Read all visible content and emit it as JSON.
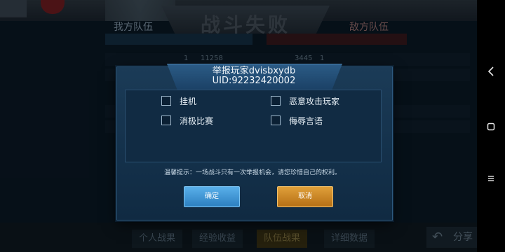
{
  "background": {
    "page_title": "战斗失败",
    "team_ours_label": "我方队伍",
    "team_enemy_label": "敌方队伍",
    "score_row": {
      "our_rank": "1",
      "our_score": "11258",
      "enemy_score": "3445",
      "enemy_rank": "1"
    },
    "bottom_tabs": [
      "个人战果",
      "经验收益",
      "队伍战果",
      "详细数据"
    ],
    "active_tab_index": 2,
    "share_label": "分享"
  },
  "report_dialog": {
    "title": "举报玩家dvisbxydb",
    "uid": "UID:92232420002",
    "options": [
      {
        "label": "挂机",
        "checked": false
      },
      {
        "label": "恶意攻击玩家",
        "checked": false
      },
      {
        "label": "消极比赛",
        "checked": false
      },
      {
        "label": "侮辱言语",
        "checked": false
      }
    ],
    "tip": "温馨提示：一场战斗只有一次举报机会，请您珍惜自己的权利。",
    "confirm_label": "确定",
    "cancel_label": "取消"
  },
  "colors": {
    "confirm_button": "#3c92d4",
    "cancel_button": "#cc8a28",
    "dialog_bg": "#14314b"
  },
  "system_nav": {
    "back_icon": "back-icon",
    "home_icon": "home-icon",
    "menu_icon": "menu-icon"
  }
}
